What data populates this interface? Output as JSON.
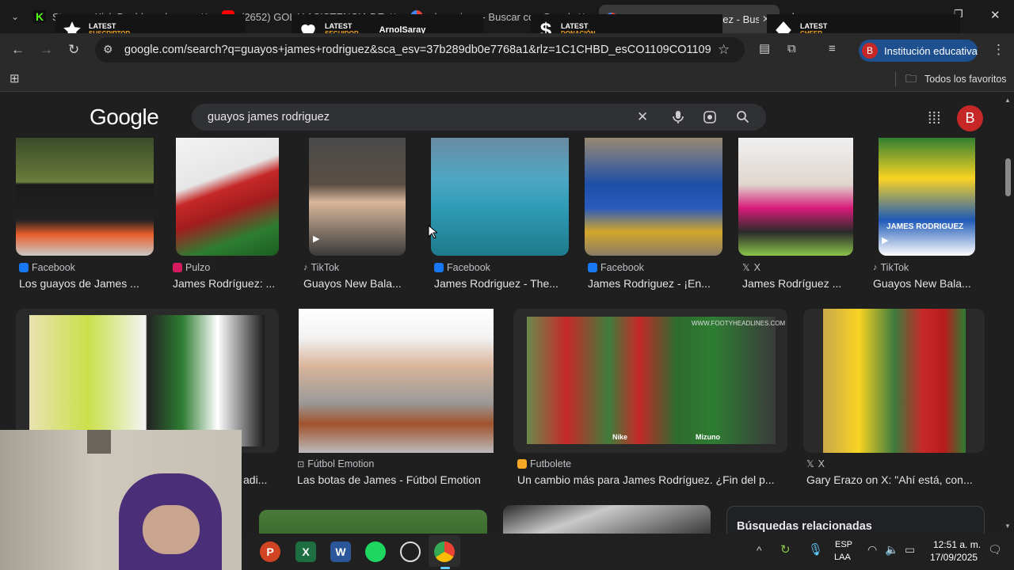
{
  "tabs": [
    {
      "title": "Stream - Kick Dashboard",
      "favicon_color": "#53fc18"
    },
    {
      "title": "(2652) GOL Y ASISTENCIA DE M",
      "favicon_color": "#ff0000"
    },
    {
      "title": "champions - Buscar con Google",
      "favicon_color": "#4285f4"
    },
    {
      "title": "guayos james rodriguez - Busca",
      "favicon_color": "#4285f4",
      "active": true
    }
  ],
  "alerts": [
    {
      "title": "LATEST",
      "sub": "SUSCRIPTOR",
      "icon": "star-icon"
    },
    {
      "title": "LATEST",
      "sub": "SEGUIDOR",
      "icon": "heart-icon",
      "name": "ArnolSaray"
    },
    {
      "title": "LATEST",
      "sub": "DONACIÓN",
      "icon": "dollar-icon"
    },
    {
      "title": "LATEST",
      "sub": "CHEER",
      "icon": "diamond-icon"
    }
  ],
  "address": {
    "url": "google.com/search?q=guayos+james+rodriguez&sca_esv=37b289db0e7768a1&rlz=1C1CHBD_esCO1109CO1109&u..."
  },
  "profile": {
    "label": "Institución educativa",
    "initial": "B"
  },
  "bookmarks": {
    "all_favorites": "Todos los favoritos"
  },
  "google": {
    "logo": "Google",
    "query": "guayos james rodriguez",
    "avatar": "B"
  },
  "row1": [
    {
      "source": "Facebook",
      "caption": "Los guayos de James ...",
      "color": "#1877f2"
    },
    {
      "source": "Pulzo",
      "caption": "James Rodríguez: ...",
      "color": "#d81b60"
    },
    {
      "source": "TikTok",
      "caption": "Guayos New Bala...",
      "color": "#ffffff"
    },
    {
      "source": "Facebook",
      "caption": "James Rodriguez - The...",
      "color": "#1877f2"
    },
    {
      "source": "Facebook",
      "caption": "James Rodriguez - ¡En...",
      "color": "#1877f2"
    },
    {
      "source": "X",
      "caption": "James Rodríguez ...",
      "color": "#ffffff"
    },
    {
      "source": "TikTok",
      "caption": "Guayos New Bala...",
      "color": "#ffffff"
    }
  ],
  "row2": [
    {
      "source": "",
      "caption": "adi..."
    },
    {
      "source": "Fútbol Emotion",
      "caption": "Las botas de James - Fútbol Emotion",
      "color": "#888888"
    },
    {
      "source": "Futbolete",
      "caption": "Un cambio más para James Rodríguez. ¿Fin del p...",
      "color": "#f9a825"
    },
    {
      "source": "X",
      "caption": "Gary Erazo on X: \"Ahí está, con...",
      "color": "#ffffff"
    }
  ],
  "image_labels": {
    "nike": "Nike",
    "mizuno": "Mizuno",
    "watermark": "WWW.FOOTYHEADLINES.COM",
    "tiktok_overlay": "JAMES RODRIGUEZ"
  },
  "related": {
    "title": "Búsquedas relacionadas"
  },
  "taskbar": {
    "lang1": "ESP",
    "lang2": "LAA",
    "time": "12:51 a. m.",
    "date": "17/09/2025"
  }
}
